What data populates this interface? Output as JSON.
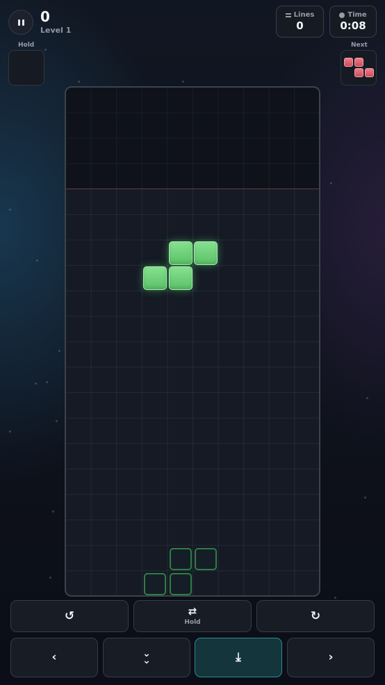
{
  "header": {
    "score": "0",
    "level": "Level 1",
    "lines_label": "Lines",
    "lines_value": "0",
    "time_label": "Time",
    "time_value": "0:08"
  },
  "hold": {
    "label": "Hold",
    "piece": null
  },
  "next": {
    "label": "Next",
    "piece": "Z",
    "color": "#e0606e"
  },
  "board": {
    "columns": 10,
    "rows": 20,
    "active_piece": {
      "type": "S",
      "color": "#6fd27a"
    },
    "ghost_color": "#2f7d46"
  },
  "controls": {
    "rotate_left_icon": "rotate-ccw-icon",
    "hold_label": "Hold",
    "hold_icon": "swap-icon",
    "rotate_right_icon": "rotate-cw-icon",
    "move_left_icon": "chevron-left-icon",
    "soft_drop_icon": "double-chevron-down-icon",
    "hard_drop_icon": "hard-drop-icon",
    "move_right_icon": "chevron-right-icon",
    "accent": "#2c8c92"
  }
}
